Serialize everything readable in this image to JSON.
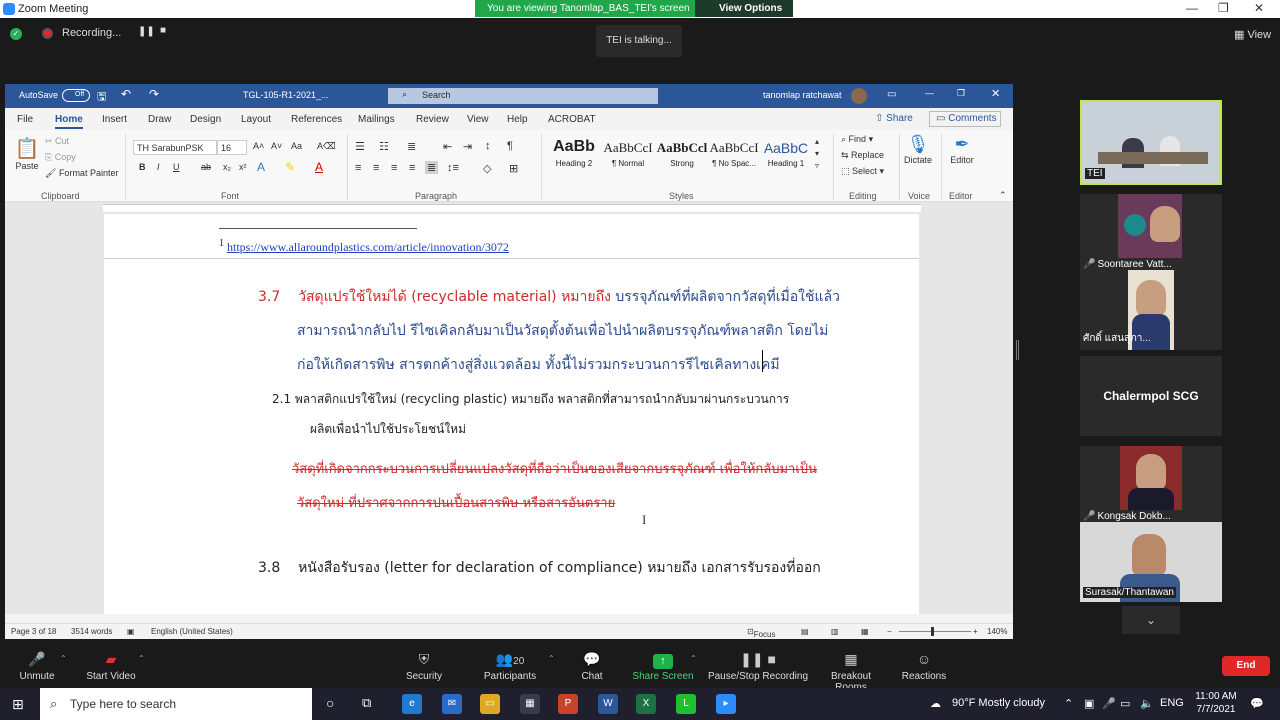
{
  "zoom": {
    "title": "Zoom Meeting",
    "viewing": "You are viewing Tanomlap_BAS_TEI's screen",
    "view_options": "View Options ⌄",
    "recording": "Recording...",
    "talking": "TEI is talking...",
    "view": "View"
  },
  "word": {
    "autosave": "AutoSave",
    "autosave_state": "Off",
    "doc_title": "TGL-105-R1-2021_... ",
    "search_placeholder": "Search",
    "user": "tanomlap ratchawat",
    "tabs": [
      "File",
      "Home",
      "Insert",
      "Draw",
      "Design",
      "Layout",
      "References",
      "Mailings",
      "Review",
      "View",
      "Help",
      "ACROBAT"
    ],
    "share": "Share",
    "comments": "Comments",
    "clipboard": {
      "paste": "Paste",
      "cut": "Cut",
      "copy": "Copy",
      "format_painter": "Format Painter",
      "label": "Clipboard"
    },
    "font": {
      "name": "TH SarabunPSK",
      "size": "16",
      "label": "Font"
    },
    "paragraph_label": "Paragraph",
    "styles": [
      {
        "sample": "AaBb",
        "name": "Heading 2"
      },
      {
        "sample": "AaBbCcI",
        "name": "¶ Normal"
      },
      {
        "sample": "AaBbCcl",
        "name": "Strong"
      },
      {
        "sample": "AaBbCcI",
        "name": "¶ No Spac..."
      },
      {
        "sample": "AaBbC",
        "name": "Heading 1"
      }
    ],
    "styles_label": "Styles",
    "editing": {
      "find": "Find",
      "replace": "Replace",
      "select": "Select",
      "label": "Editing"
    },
    "voice": {
      "dictate": "Dictate",
      "label": "Voice"
    },
    "editor": {
      "btn": "Editor",
      "label": "Editor"
    },
    "footnote_num": "1",
    "footnote_link": "https://www.allaroundplastics.com/article/innovation/3072",
    "sec37_num": "3.7",
    "sec37_title": "วัสดุแปรใช้ใหม่ได้ (recyclable material) หมายถึง",
    "sec37_line1": " บรรจุภัณฑ์ที่ผลิตจากวัสดุที่เมื่อใช้แล้ว",
    "sec37_line2": "สามารถนำกลับไป รีไซเคิลกลับมาเป็นวัสดุตั้งต้นเพื่อไปนำผลิตบรรจุภัณฑ์พลาสติก โดยไม่",
    "sec37_line3": "ก่อให้เกิดสารพิษ สารตกค้างสู่สิ่งแวดล้อม ทั้งนี้ไม่รวมกระบวนการรีไซเคิลทางเคมี",
    "sec21_line1": "2.1   พลาสติกแปรใช้ใหม่ (recycling plastic)  หมายถึง พลาสติกที่สามารถนำกลับมาผ่านกระบวนการ",
    "sec21_line2": "ผลิตเพื่อนำไปใช้ประโยชน์ใหม่",
    "strike_line1": "วัสดุที่เกิดจากกระบวนการเปลี่ยนแปลงวัสดุที่ถือว่าเป็นของเสียจากบรรจุภัณฑ์ เพื่อให้กลับมาเป็น",
    "strike_line2": "วัสดุใหม่ ที่ปราศจากการปนเปื้อนสารพิษ หรือสารอันตราย",
    "sec38_num": "3.8",
    "sec38_text": "หนังสือรับรอง (letter for declaration of compliance) หมายถึง เอกสารรับรองที่ออก",
    "status": {
      "page": "Page 3 of 18",
      "words": "3514 words",
      "lang": "English (United States)",
      "focus": "Focus",
      "zoom": "140%"
    }
  },
  "participants": [
    {
      "name": "TEI",
      "muted": false
    },
    {
      "name": "Soontaree Vatt...",
      "muted": true
    },
    {
      "name": "ศักดิ์ แสนสุภา...",
      "muted": false
    },
    {
      "name": "Chalermpol SCG",
      "muted": false
    },
    {
      "name": "Kongsak Dokb...",
      "muted": true
    },
    {
      "name": "Surasak/Thantawan",
      "muted": false
    }
  ],
  "toolbar": {
    "unmute": "Unmute",
    "start_video": "Start Video",
    "security": "Security",
    "participants": "Participants",
    "participant_count": "20",
    "chat": "Chat",
    "share_screen": "Share Screen",
    "pause_recording": "Pause/Stop Recording",
    "breakout": "Breakout Rooms",
    "reactions": "Reactions",
    "end": "End"
  },
  "taskbar": {
    "search_placeholder": "Type here to search",
    "weather": "90°F  Mostly cloudy",
    "lang": "ENG",
    "time": "11:00 AM",
    "date": "7/7/2021"
  }
}
